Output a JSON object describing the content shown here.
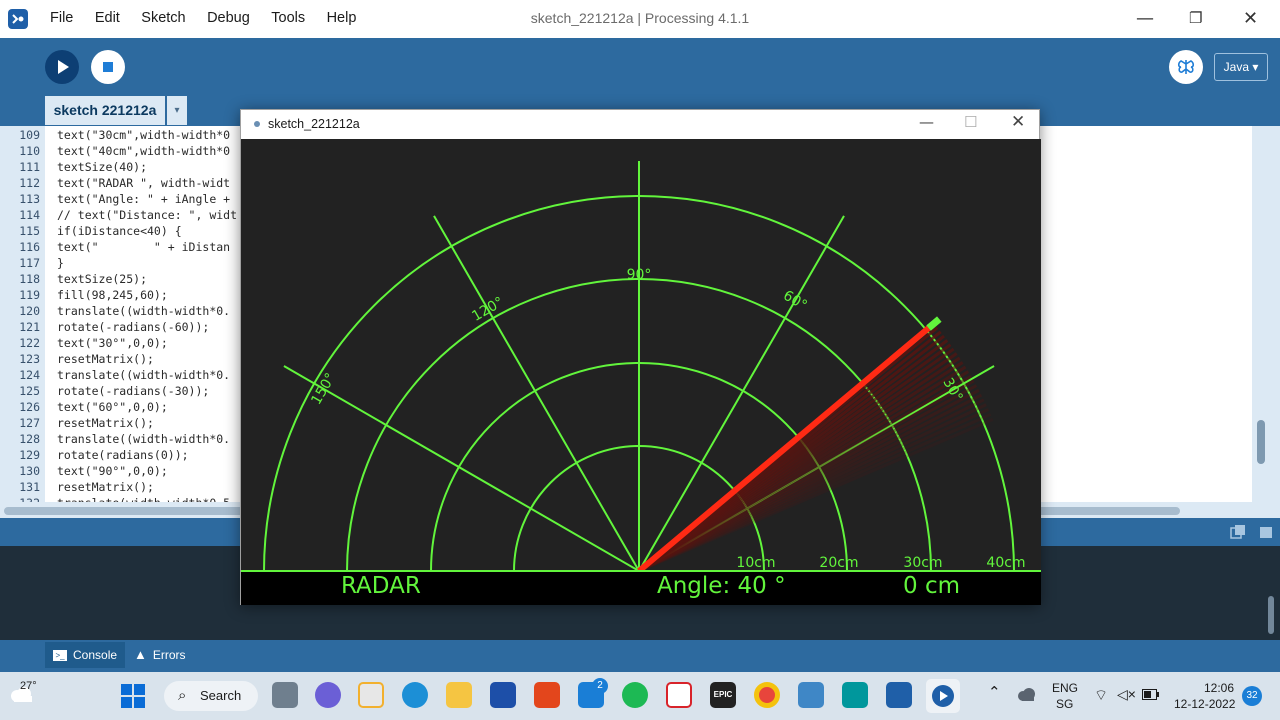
{
  "ide": {
    "menu": [
      "File",
      "Edit",
      "Sketch",
      "Debug",
      "Tools",
      "Help"
    ],
    "window_title": "sketch_221212a | Processing 4.1.1",
    "window_controls": {
      "minimize": "—",
      "maximize": "❐",
      "close": "✕"
    },
    "toolbar": {
      "run_icon": "play-icon",
      "stop_icon": "stop-icon",
      "mode_icon": "butterfly-icon",
      "mode": "Java ▾"
    },
    "tab": {
      "label": "sketch 221212a",
      "arrow": "▾"
    },
    "code_lines": [
      {
        "n": "109",
        "t": "text(\"30cm\",width-width*0"
      },
      {
        "n": "110",
        "t": "text(\"40cm\",width-width*0"
      },
      {
        "n": "111",
        "t": "textSize(40);"
      },
      {
        "n": "112",
        "t": "text(\"RADAR \", width-widt"
      },
      {
        "n": "113",
        "t": "text(\"Angle: \" + iAngle +"
      },
      {
        "n": "114",
        "t": "// text(\"Distance: \", widt"
      },
      {
        "n": "115",
        "t": "if(iDistance<40) {"
      },
      {
        "n": "116",
        "t": "text(\"        \" + iDistan"
      },
      {
        "n": "117",
        "t": "}"
      },
      {
        "n": "118",
        "t": "textSize(25);"
      },
      {
        "n": "119",
        "t": "fill(98,245,60);"
      },
      {
        "n": "120",
        "t": "translate((width-width*0."
      },
      {
        "n": "121",
        "t": "rotate(-radians(-60));"
      },
      {
        "n": "122",
        "t": "text(\"30°\",0,0);"
      },
      {
        "n": "123",
        "t": "resetMatrix();"
      },
      {
        "n": "124",
        "t": "translate((width-width*0."
      },
      {
        "n": "125",
        "t": "rotate(-radians(-30));"
      },
      {
        "n": "126",
        "t": "text(\"60°\",0,0);"
      },
      {
        "n": "127",
        "t": "resetMatrix();"
      },
      {
        "n": "128",
        "t": "translate((width-width*0."
      },
      {
        "n": "129",
        "t": "rotate(radians(0));"
      },
      {
        "n": "130",
        "t": "text(\"90°\",0,0);"
      },
      {
        "n": "131",
        "t": "resetMatrix();"
      },
      {
        "n": "132",
        "t": "translate(width-width*0.5"
      }
    ],
    "console_tabs": {
      "console": "Console",
      "errors": "Errors"
    }
  },
  "sketch_window": {
    "title": "sketch_221212a",
    "controls": {
      "minimize": "—",
      "maximize": "☐",
      "close": "✕"
    },
    "radar": {
      "angle_labels": [
        "30°",
        "60°",
        "90°",
        "120°",
        "150°"
      ],
      "distance_labels": [
        "10cm",
        "20cm",
        "30cm",
        "40cm"
      ],
      "radar_label": "RADAR",
      "angle_text": "Angle: 40 °",
      "distance_text": "0 cm",
      "sweep_angle_deg": 40,
      "colors": {
        "green": "#62f53c",
        "red": "#ff2a14",
        "background": "#222222"
      }
    }
  },
  "taskbar": {
    "weather": "27°",
    "search": "Search",
    "mail_badge": "2",
    "epic_label": "EPIC",
    "lang_top": "ENG",
    "lang_bottom": "SG",
    "time": "12:06",
    "date": "12-12-2022",
    "notif_count": "32"
  }
}
